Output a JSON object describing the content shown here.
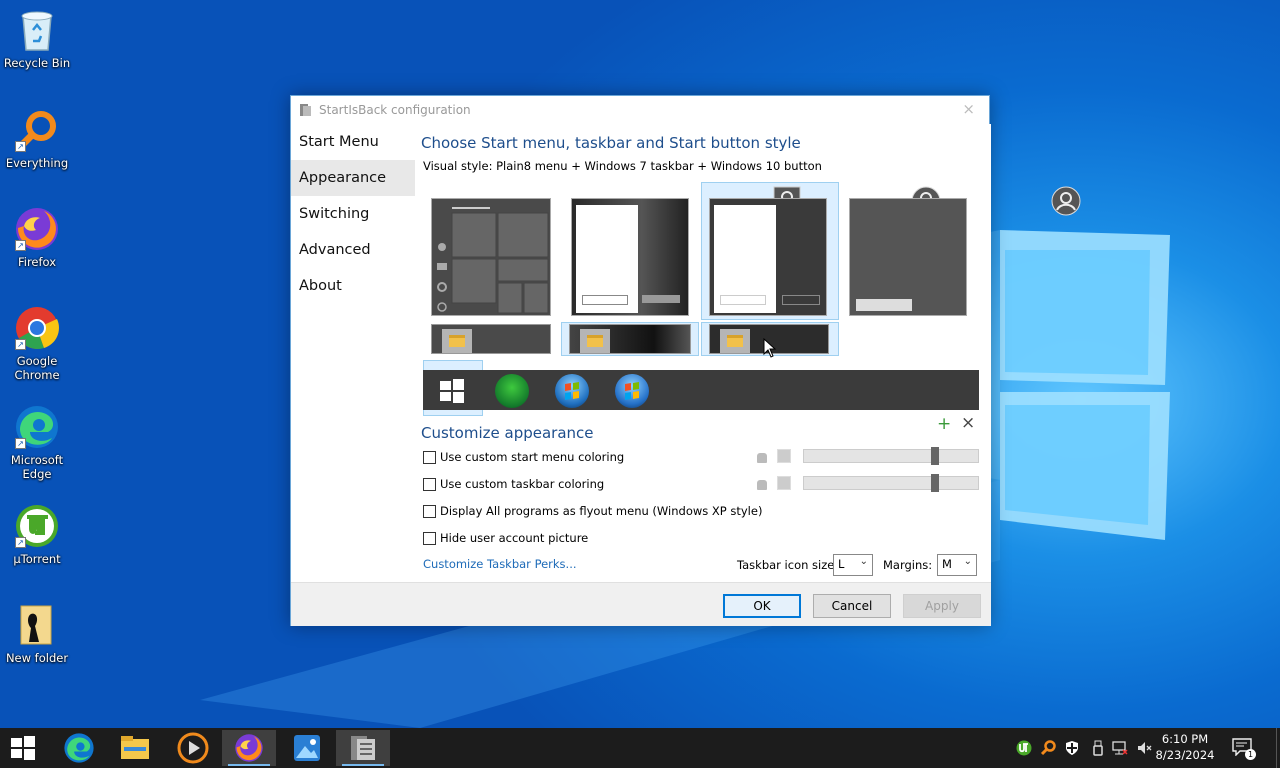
{
  "desktop": {
    "icons": [
      {
        "label": "Recycle Bin"
      },
      {
        "label": "Everything"
      },
      {
        "label": "Firefox"
      },
      {
        "label": "Google Chrome"
      },
      {
        "label": "Microsoft Edge"
      },
      {
        "label": "µTorrent"
      },
      {
        "label": "New folder"
      }
    ]
  },
  "dialog": {
    "title": "StartIsBack configuration",
    "close_glyph": "×",
    "sidebar": [
      {
        "label": "Start Menu"
      },
      {
        "label": "Appearance"
      },
      {
        "label": "Switching"
      },
      {
        "label": "Advanced"
      },
      {
        "label": "About"
      }
    ],
    "heading": "Choose Start menu, taskbar and Start button style",
    "visual_style": "Visual style:  Plain8 menu + Windows 7 taskbar + Windows 10 button",
    "customize_heading": "Customize appearance",
    "add_glyph": "+",
    "remove_glyph": "×",
    "options": [
      {
        "label": "Use custom start menu coloring",
        "checked": false
      },
      {
        "label": "Use custom taskbar coloring",
        "checked": false
      },
      {
        "label": "Display All programs as flyout menu (Windows XP style)",
        "checked": false
      },
      {
        "label": "Hide user account picture",
        "checked": false
      }
    ],
    "sliders": [
      0.75,
      0.75
    ],
    "link": "Customize Taskbar Perks...",
    "icon_size_label": "Taskbar icon size:",
    "icon_size_value": "L",
    "margins_label": "Margins:",
    "margins_value": "M",
    "buttons": {
      "ok": "OK",
      "cancel": "Cancel",
      "apply": "Apply"
    }
  },
  "taskbar": {
    "time": "6:10 PM",
    "date": "8/23/2024",
    "notification_count": "1"
  }
}
